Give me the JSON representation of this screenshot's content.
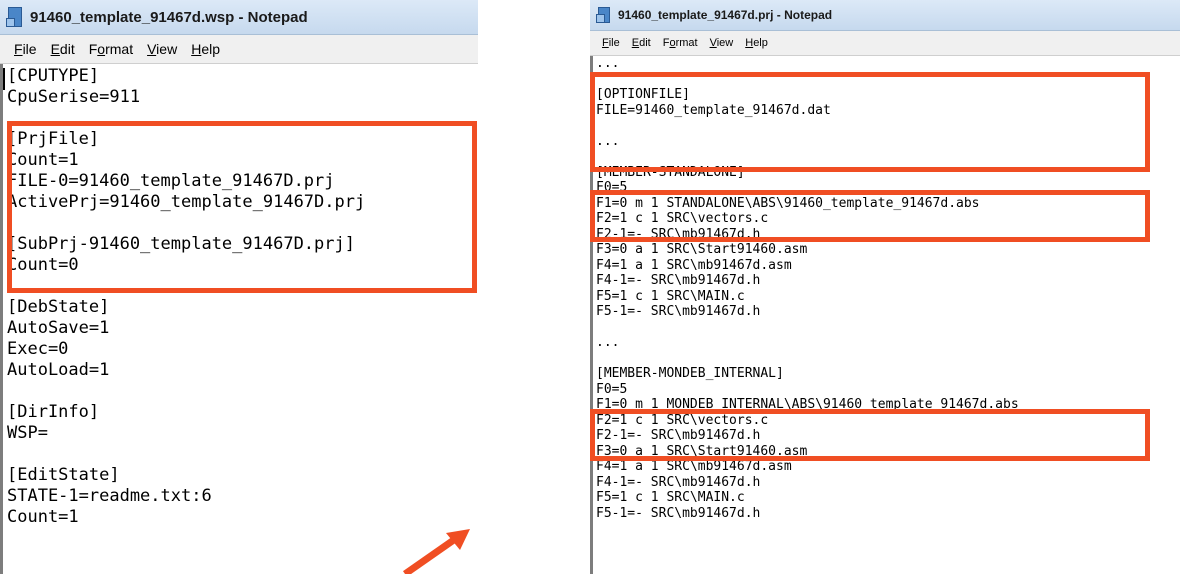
{
  "left_window": {
    "title": "91460_template_91467d.wsp - Notepad",
    "menu": [
      {
        "label": "File",
        "accel": "F",
        "rest": "ile"
      },
      {
        "label": "Edit",
        "accel": "E",
        "rest": "dit"
      },
      {
        "label": "Format",
        "pre": "F",
        "accel": "o",
        "rest": "rmat"
      },
      {
        "label": "View",
        "accel": "V",
        "rest": "iew"
      },
      {
        "label": "Help",
        "accel": "H",
        "rest": "elp"
      }
    ],
    "content": "[CPUTYPE]\nCpuSerise=911\n\n[PrjFile]\nCount=1\nFILE-0=91460_template_91467D.prj\nActivePrj=91460_template_91467D.prj\n\n[SubPrj-91460_template_91467D.prj]\nCount=0\n\n[DebState]\nAutoSave=1\nExec=0\nAutoLoad=1\n\n[DirInfo]\nWSP=\n\n[EditState]\nSTATE-1=readme.txt:6\nCount=1"
  },
  "right_window": {
    "title": "91460_template_91467d.prj - Notepad",
    "menu": [
      {
        "label": "File",
        "accel": "F",
        "rest": "ile"
      },
      {
        "label": "Edit",
        "accel": "E",
        "rest": "dit"
      },
      {
        "label": "Format",
        "pre": "F",
        "accel": "o",
        "rest": "rmat"
      },
      {
        "label": "View",
        "accel": "V",
        "rest": "iew"
      },
      {
        "label": "Help",
        "accel": "H",
        "rest": "elp"
      }
    ],
    "content": "...\n\n[OPTIONFILE]\nFILE=91460_template_91467d.dat\n\n...\n\n[MEMBER-STANDALONE]\nF0=5\nF1=0 m 1 STANDALONE\\ABS\\91460_template_91467d.abs\nF2=1 c 1 SRC\\vectors.c\nF2-1=- SRC\\mb91467d.h\nF3=0 a 1 SRC\\Start91460.asm\nF4=1 a 1 SRC\\mb91467d.asm\nF4-1=- SRC\\mb91467d.h\nF5=1 c 1 SRC\\MAIN.c\nF5-1=- SRC\\mb91467d.h\n\n...\n\n[MEMBER-MONDEB_INTERNAL]\nF0=5\nF1=0 m 1 MONDEB_INTERNAL\\ABS\\91460_template_91467d.abs\nF2=1 c 1 SRC\\vectors.c\nF2-1=- SRC\\mb91467d.h\nF3=0 a 1 SRC\\Start91460.asm\nF4=1 a 1 SRC\\mb91467d.asm\nF4-1=- SRC\\mb91467d.h\nF5=1 c 1 SRC\\MAIN.c\nF5-1=- SRC\\mb91467d.h"
  },
  "colors": {
    "highlight": "#f04e23",
    "titlebar": "#c6d9ee"
  },
  "icons": [
    "notepad-icon",
    "arrow-icon"
  ]
}
